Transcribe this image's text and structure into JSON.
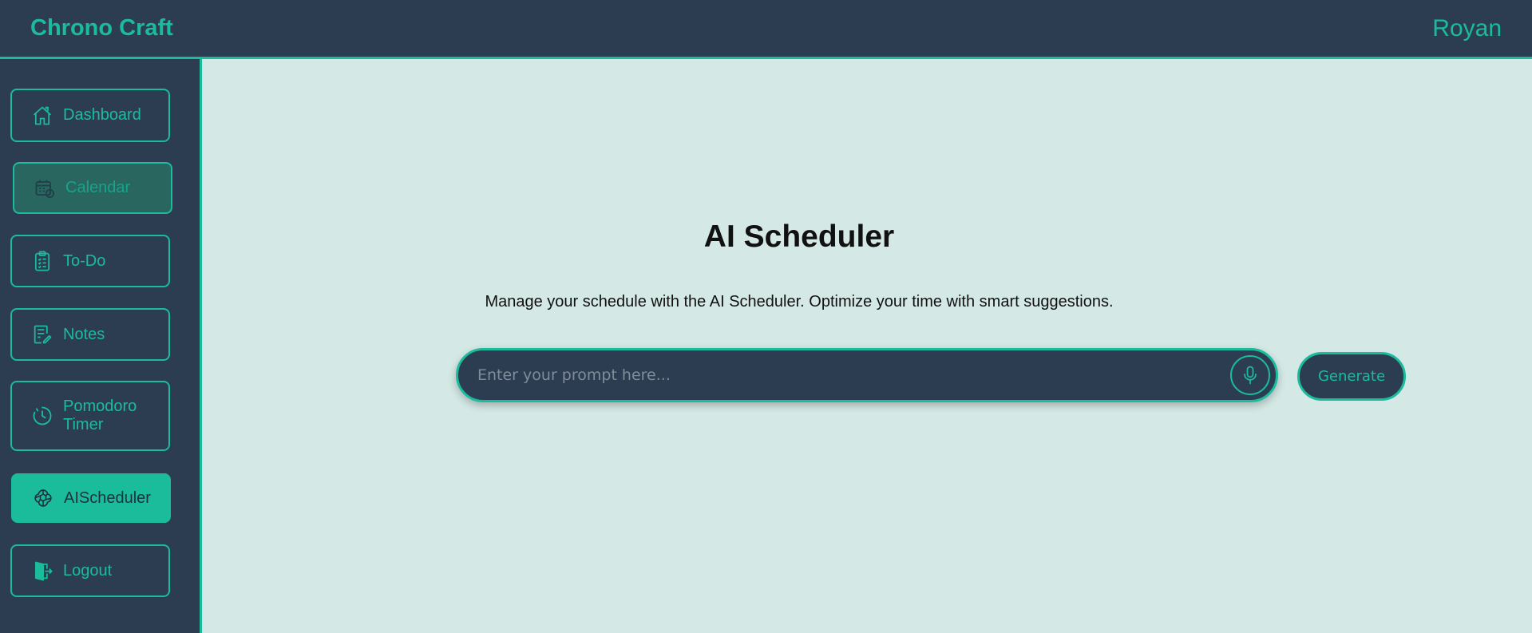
{
  "app": {
    "brand": "Chrono Craft",
    "user": "Royan"
  },
  "sidebar": {
    "items": [
      {
        "label": "Dashboard",
        "icon": "home-icon"
      },
      {
        "label": "Calendar",
        "icon": "calendar-clock-icon",
        "state": "hover"
      },
      {
        "label": "To-Do",
        "icon": "clipboard-list-icon"
      },
      {
        "label": "Notes",
        "icon": "note-edit-icon"
      },
      {
        "label": "Pomodoro Timer",
        "icon": "timer-icon"
      },
      {
        "label": "AIScheduler",
        "icon": "openai-icon",
        "state": "active"
      },
      {
        "label": "Logout",
        "icon": "door-exit-icon"
      }
    ]
  },
  "main": {
    "title": "AI Scheduler",
    "description": "Manage your schedule with the AI Scheduler. Optimize your time with smart suggestions.",
    "prompt": {
      "placeholder": "Enter your prompt here...",
      "value": ""
    },
    "generate_label": "Generate"
  },
  "colors": {
    "accent": "#1abc9c",
    "panel": "#2c3d52",
    "background": "#d4e8e5"
  }
}
